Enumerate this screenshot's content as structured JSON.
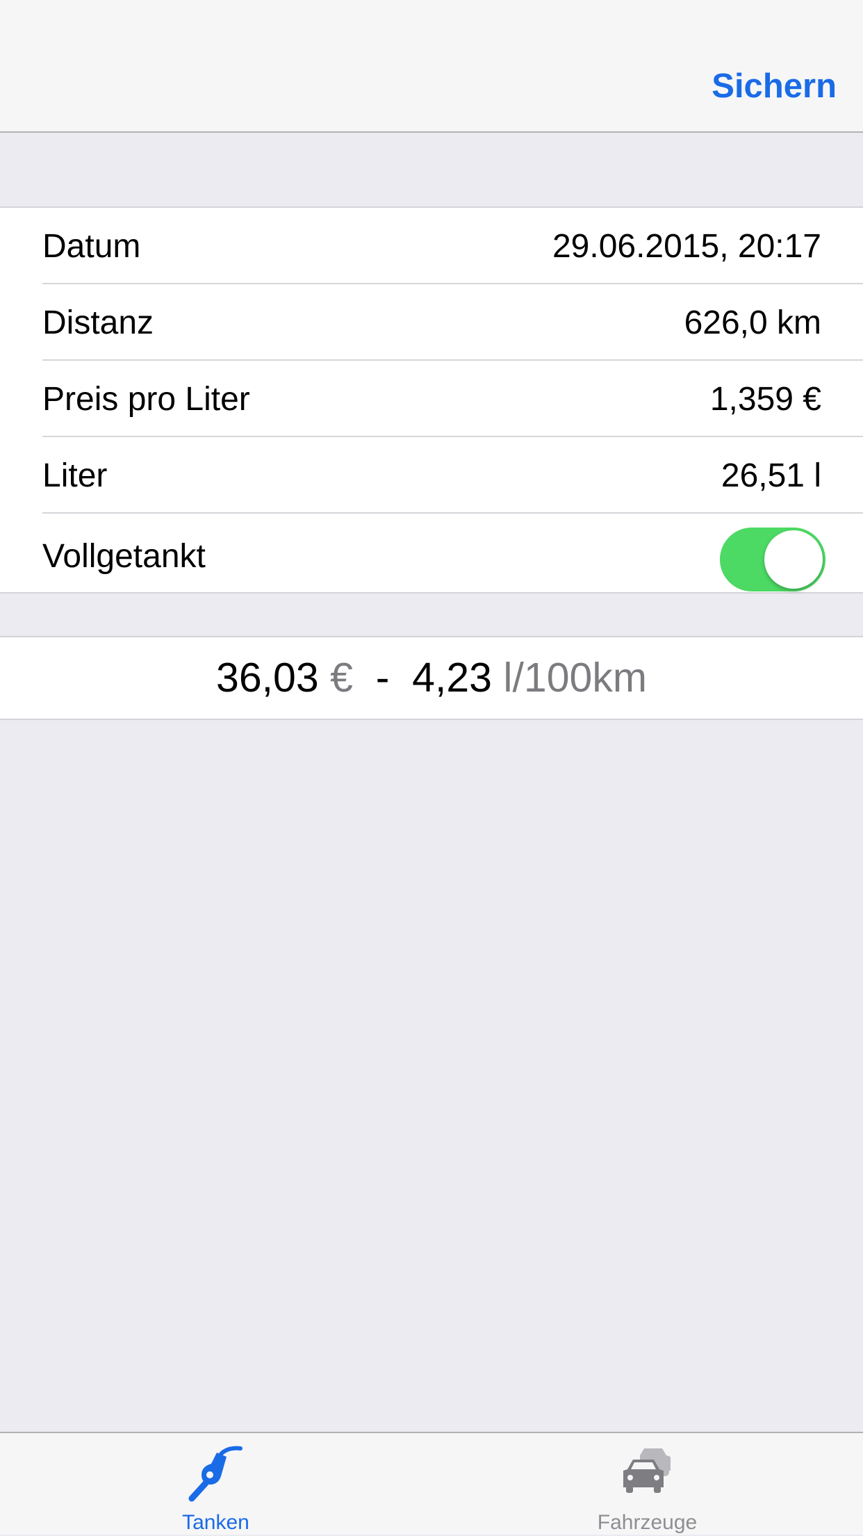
{
  "navbar": {
    "save_label": "Sichern"
  },
  "form": {
    "rows": [
      {
        "label": "Datum",
        "value": "29.06.2015, 20:17"
      },
      {
        "label": "Distanz",
        "value": "626,0 km"
      },
      {
        "label": "Preis pro Liter",
        "value": "1,359 €"
      },
      {
        "label": "Liter",
        "value": "26,51 l"
      },
      {
        "label": "Vollgetankt",
        "toggle_on": true
      }
    ]
  },
  "summary": {
    "cost": "36,03",
    "currency": "€",
    "separator": "-",
    "consumption": "4,23",
    "consumption_unit": "l/100km"
  },
  "tabbar": {
    "tabs": [
      {
        "label": "Tanken",
        "icon": "fuel-nozzle-icon",
        "active": true
      },
      {
        "label": "Fahrzeuge",
        "icon": "cars-icon",
        "active": false
      }
    ]
  },
  "colors": {
    "accent": "#1a6be6",
    "toggle_on": "#4cd964",
    "inactive": "#8e8e93"
  }
}
